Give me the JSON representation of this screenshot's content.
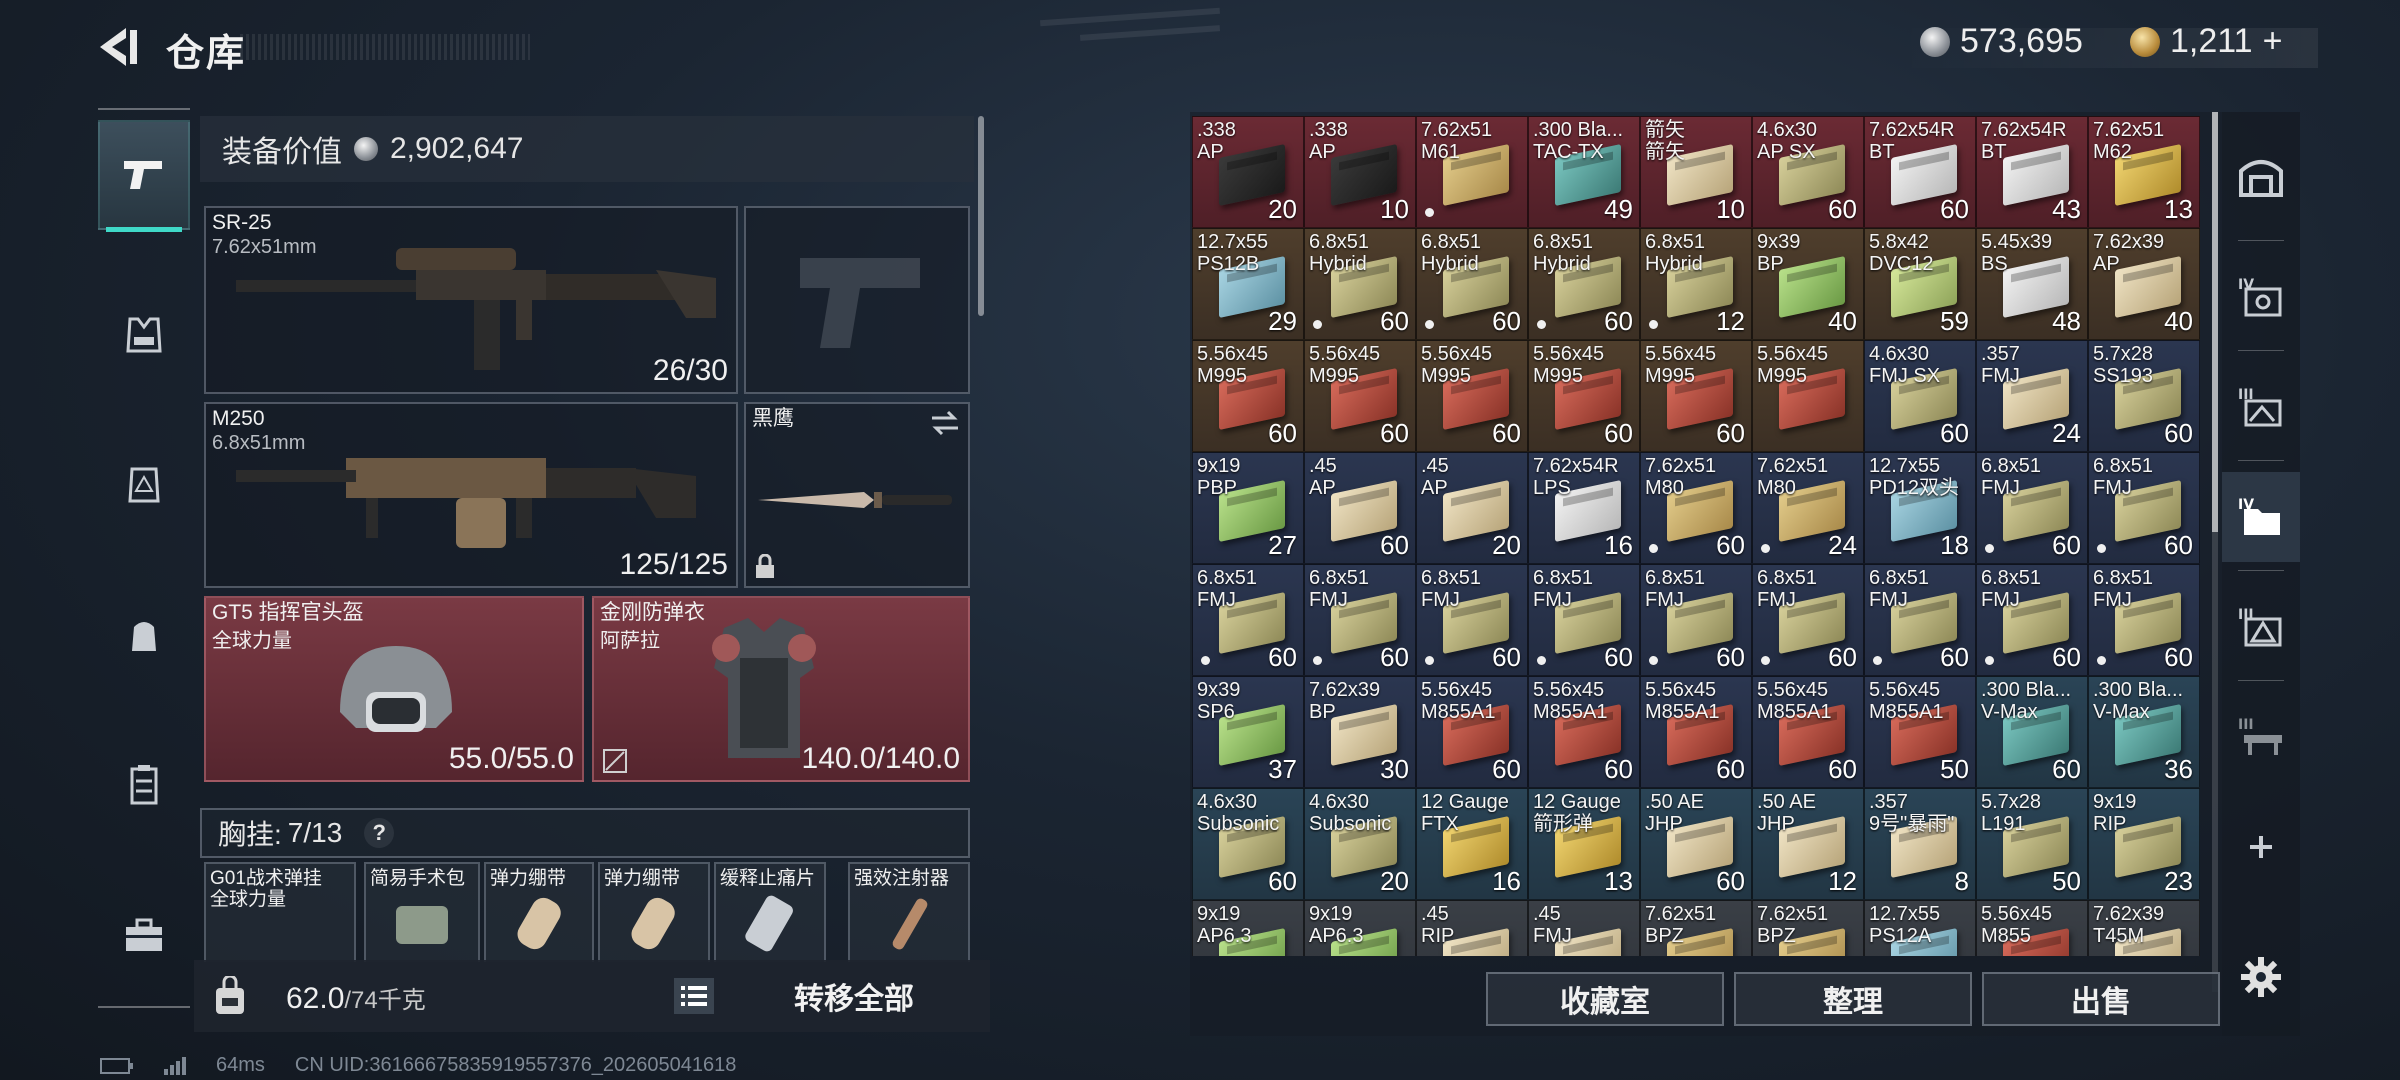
{
  "header": {
    "title": "仓库",
    "silver_amount": "573,695",
    "gold_amount": "1,211",
    "gold_plus": "+"
  },
  "loadout": {
    "equip_value_label": "装备价值",
    "equip_value": "2,902,647",
    "primary": {
      "name": "SR-25",
      "caliber": "7.62x51mm",
      "ammo": "26/30"
    },
    "secondary": {
      "name": "M250",
      "caliber": "6.8x51mm",
      "ammo": "125/125"
    },
    "melee": {
      "name": "黑鹰"
    },
    "helmet": {
      "name": "GT5 指挥官头盔",
      "brand": "全球力量",
      "durability": "55.0/55.0"
    },
    "armor": {
      "name": "金刚防弹衣",
      "brand": "阿萨拉",
      "durability": "140.0/140.0"
    },
    "chest_rig": {
      "label": "胸挂:",
      "count": "7/13",
      "help": "?"
    },
    "chest_items": [
      {
        "name": "G01战术弹挂",
        "sub": "全球力量"
      },
      {
        "name": "简易手术包",
        "sub": ""
      },
      {
        "name": "弹力绷带",
        "sub": ""
      },
      {
        "name": "弹力绷带",
        "sub": ""
      },
      {
        "name": "缓释止痛片",
        "sub": ""
      },
      {
        "name": "强效注射器",
        "sub": ""
      }
    ],
    "weight": "62.0",
    "weight_max": "/74千克",
    "transfer_all": "转移全部"
  },
  "status": {
    "ping": "64ms",
    "uid": "CN UID:36166675835919557376_202605041618"
  },
  "actions": {
    "collection": "收藏室",
    "sort": "整理",
    "sell": "出售"
  },
  "icons": {
    "back": "back-arrow-icon",
    "settings": "gear-icon",
    "add": "plus-icon"
  },
  "grid": [
    [
      {
        "cal": [
          ".338",
          "AP"
        ],
        "qty": "20",
        "bg": "red",
        "box": "black",
        "dot": false
      },
      {
        "cal": [
          ".338",
          "AP"
        ],
        "qty": "10",
        "bg": "red",
        "box": "black",
        "dot": false
      },
      {
        "cal": [
          "7.62x51",
          "M61"
        ],
        "qty": "",
        "bg": "red",
        "box": "tan",
        "dot": true
      },
      {
        "cal": [
          ".300 Bla...",
          "TAC-TX"
        ],
        "qty": "49",
        "bg": "red",
        "box": "teal",
        "dot": false
      },
      {
        "cal": [
          "箭矢",
          "箭矢"
        ],
        "qty": "10",
        "bg": "red",
        "box": "cream",
        "dot": false
      },
      {
        "cal": [
          "4.6x30",
          "AP SX"
        ],
        "qty": "60",
        "bg": "red",
        "box": "khaki",
        "dot": false
      },
      {
        "cal": [
          "7.62x54R",
          "BT"
        ],
        "qty": "60",
        "bg": "red",
        "box": "white",
        "dot": false
      },
      {
        "cal": [
          "7.62x54R",
          "BT"
        ],
        "qty": "43",
        "bg": "red",
        "box": "white",
        "dot": false
      },
      {
        "cal": [
          "7.62x51",
          "M62"
        ],
        "qty": "13",
        "bg": "red",
        "box": "yellow",
        "dot": false
      }
    ],
    [
      {
        "cal": [
          "12.7x55",
          "PS12B"
        ],
        "qty": "29",
        "bg": "brown",
        "box": "lblue",
        "dot": false
      },
      {
        "cal": [
          "6.8x51",
          "Hybrid"
        ],
        "qty": "60",
        "bg": "brown",
        "box": "khaki",
        "dot": true
      },
      {
        "cal": [
          "6.8x51",
          "Hybrid"
        ],
        "qty": "60",
        "bg": "brown",
        "box": "khaki",
        "dot": true
      },
      {
        "cal": [
          "6.8x51",
          "Hybrid"
        ],
        "qty": "60",
        "bg": "brown",
        "box": "khaki",
        "dot": true
      },
      {
        "cal": [
          "6.8x51",
          "Hybrid"
        ],
        "qty": "12",
        "bg": "brown",
        "box": "khaki",
        "dot": true
      },
      {
        "cal": [
          "9x39",
          "BP"
        ],
        "qty": "40",
        "bg": "brown",
        "box": "green",
        "dot": false
      },
      {
        "cal": [
          "5.8x42",
          "DVC12"
        ],
        "qty": "59",
        "bg": "brown",
        "box": "lime",
        "dot": false
      },
      {
        "cal": [
          "5.45x39",
          "BS"
        ],
        "qty": "48",
        "bg": "brown",
        "box": "white",
        "dot": false
      },
      {
        "cal": [
          "7.62x39",
          "AP"
        ],
        "qty": "40",
        "bg": "brown",
        "box": "cream",
        "dot": false
      }
    ],
    [
      {
        "cal": [
          "5.56x45",
          "M995"
        ],
        "qty": "60",
        "bg": "brown",
        "box": "red",
        "dot": false
      },
      {
        "cal": [
          "5.56x45",
          "M995"
        ],
        "qty": "60",
        "bg": "brown",
        "box": "red",
        "dot": false
      },
      {
        "cal": [
          "5.56x45",
          "M995"
        ],
        "qty": "60",
        "bg": "brown",
        "box": "red",
        "dot": false
      },
      {
        "cal": [
          "5.56x45",
          "M995"
        ],
        "qty": "60",
        "bg": "brown",
        "box": "red",
        "dot": false
      },
      {
        "cal": [
          "5.56x45",
          "M995"
        ],
        "qty": "60",
        "bg": "brown",
        "box": "red",
        "dot": false
      },
      {
        "cal": [
          "5.56x45",
          "M995"
        ],
        "qty": "",
        "bg": "brown",
        "box": "red",
        "dot": false
      },
      {
        "cal": [
          "4.6x30",
          "FMJ SX"
        ],
        "qty": "60",
        "bg": "navy",
        "box": "khaki",
        "dot": false
      },
      {
        "cal": [
          ".357",
          "FMJ"
        ],
        "qty": "24",
        "bg": "navy",
        "box": "cream",
        "dot": false
      },
      {
        "cal": [
          "5.7x28",
          "SS193"
        ],
        "qty": "60",
        "bg": "navy",
        "box": "khaki",
        "dot": false
      }
    ],
    [
      {
        "cal": [
          "9x19",
          "PBP"
        ],
        "qty": "27",
        "bg": "navy",
        "box": "green",
        "dot": false
      },
      {
        "cal": [
          ".45",
          "AP"
        ],
        "qty": "60",
        "bg": "navy",
        "box": "cream",
        "dot": false
      },
      {
        "cal": [
          ".45",
          "AP"
        ],
        "qty": "20",
        "bg": "navy",
        "box": "cream",
        "dot": false
      },
      {
        "cal": [
          "7.62x54R",
          "LPS"
        ],
        "qty": "16",
        "bg": "navy",
        "box": "white",
        "dot": false
      },
      {
        "cal": [
          "7.62x51",
          "M80"
        ],
        "qty": "60",
        "bg": "navy",
        "box": "tan",
        "dot": true
      },
      {
        "cal": [
          "7.62x51",
          "M80"
        ],
        "qty": "24",
        "bg": "navy",
        "box": "tan",
        "dot": true
      },
      {
        "cal": [
          "12.7x55",
          "PD12双头"
        ],
        "qty": "18",
        "bg": "navy",
        "box": "lblue",
        "dot": false
      },
      {
        "cal": [
          "6.8x51",
          "FMJ"
        ],
        "qty": "60",
        "bg": "navy",
        "box": "khaki",
        "dot": true
      },
      {
        "cal": [
          "6.8x51",
          "FMJ"
        ],
        "qty": "60",
        "bg": "navy",
        "box": "khaki",
        "dot": true
      }
    ],
    [
      {
        "cal": [
          "6.8x51",
          "FMJ"
        ],
        "qty": "60",
        "bg": "navy",
        "box": "khaki",
        "dot": true
      },
      {
        "cal": [
          "6.8x51",
          "FMJ"
        ],
        "qty": "60",
        "bg": "navy",
        "box": "khaki",
        "dot": true
      },
      {
        "cal": [
          "6.8x51",
          "FMJ"
        ],
        "qty": "60",
        "bg": "navy",
        "box": "khaki",
        "dot": true
      },
      {
        "cal": [
          "6.8x51",
          "FMJ"
        ],
        "qty": "60",
        "bg": "navy",
        "box": "khaki",
        "dot": true
      },
      {
        "cal": [
          "6.8x51",
          "FMJ"
        ],
        "qty": "60",
        "bg": "navy",
        "box": "khaki",
        "dot": true
      },
      {
        "cal": [
          "6.8x51",
          "FMJ"
        ],
        "qty": "60",
        "bg": "navy",
        "box": "khaki",
        "dot": true
      },
      {
        "cal": [
          "6.8x51",
          "FMJ"
        ],
        "qty": "60",
        "bg": "navy",
        "box": "khaki",
        "dot": true
      },
      {
        "cal": [
          "6.8x51",
          "FMJ"
        ],
        "qty": "60",
        "bg": "navy",
        "box": "khaki",
        "dot": true
      },
      {
        "cal": [
          "6.8x51",
          "FMJ"
        ],
        "qty": "60",
        "bg": "navy",
        "box": "khaki",
        "dot": true
      }
    ],
    [
      {
        "cal": [
          "9x39",
          "SP6"
        ],
        "qty": "37",
        "bg": "navy",
        "box": "green",
        "dot": false
      },
      {
        "cal": [
          "7.62x39",
          "BP"
        ],
        "qty": "30",
        "bg": "navy",
        "box": "cream",
        "dot": false
      },
      {
        "cal": [
          "5.56x45",
          "M855A1"
        ],
        "qty": "60",
        "bg": "navy",
        "box": "red",
        "dot": false
      },
      {
        "cal": [
          "5.56x45",
          "M855A1"
        ],
        "qty": "60",
        "bg": "navy",
        "box": "red",
        "dot": false
      },
      {
        "cal": [
          "5.56x45",
          "M855A1"
        ],
        "qty": "60",
        "bg": "navy",
        "box": "red",
        "dot": false
      },
      {
        "cal": [
          "5.56x45",
          "M855A1"
        ],
        "qty": "60",
        "bg": "navy",
        "box": "red",
        "dot": false
      },
      {
        "cal": [
          "5.56x45",
          "M855A1"
        ],
        "qty": "50",
        "bg": "navy",
        "box": "red",
        "dot": false
      },
      {
        "cal": [
          ".300 Bla...",
          "V-Max"
        ],
        "qty": "60",
        "bg": "teal",
        "box": "teal",
        "dot": false
      },
      {
        "cal": [
          ".300 Bla...",
          "V-Max"
        ],
        "qty": "36",
        "bg": "teal",
        "box": "teal",
        "dot": false
      }
    ],
    [
      {
        "cal": [
          "4.6x30",
          "Subsonic"
        ],
        "qty": "60",
        "bg": "teal",
        "box": "khaki",
        "dot": false
      },
      {
        "cal": [
          "4.6x30",
          "Subsonic"
        ],
        "qty": "20",
        "bg": "teal",
        "box": "khaki",
        "dot": false
      },
      {
        "cal": [
          "12 Gauge",
          "FTX"
        ],
        "qty": "16",
        "bg": "teal",
        "box": "yellow",
        "dot": false
      },
      {
        "cal": [
          "12 Gauge",
          "箭形弹"
        ],
        "qty": "13",
        "bg": "teal",
        "box": "yellow",
        "dot": false
      },
      {
        "cal": [
          ".50 AE",
          "JHP"
        ],
        "qty": "60",
        "bg": "teal",
        "box": "cream",
        "dot": false
      },
      {
        "cal": [
          ".50 AE",
          "JHP"
        ],
        "qty": "12",
        "bg": "teal",
        "box": "cream",
        "dot": false
      },
      {
        "cal": [
          ".357",
          "9号\"暴雨\""
        ],
        "qty": "8",
        "bg": "teal",
        "box": "cream",
        "dot": false
      },
      {
        "cal": [
          "5.7x28",
          "L191"
        ],
        "qty": "50",
        "bg": "teal",
        "box": "khaki",
        "dot": false
      },
      {
        "cal": [
          "9x19",
          "RIP"
        ],
        "qty": "23",
        "bg": "teal",
        "box": "khaki",
        "dot": false
      }
    ],
    [
      {
        "cal": [
          "9x19",
          "AP6.3"
        ],
        "qty": "",
        "bg": "gray",
        "box": "green",
        "dot": false
      },
      {
        "cal": [
          "9x19",
          "AP6.3"
        ],
        "qty": "",
        "bg": "gray",
        "box": "green",
        "dot": false
      },
      {
        "cal": [
          ".45",
          "RIP"
        ],
        "qty": "",
        "bg": "gray",
        "box": "cream",
        "dot": false
      },
      {
        "cal": [
          ".45",
          "FMJ"
        ],
        "qty": "",
        "bg": "gray",
        "box": "cream",
        "dot": false
      },
      {
        "cal": [
          "7.62x51",
          "BPZ"
        ],
        "qty": "",
        "bg": "gray",
        "box": "tan",
        "dot": false
      },
      {
        "cal": [
          "7.62x51",
          "BPZ"
        ],
        "qty": "",
        "bg": "gray",
        "box": "tan",
        "dot": false
      },
      {
        "cal": [
          "12.7x55",
          "PS12A"
        ],
        "qty": "",
        "bg": "gray",
        "box": "lblue",
        "dot": false
      },
      {
        "cal": [
          "5.56x45",
          "M855"
        ],
        "qty": "",
        "bg": "gray",
        "box": "red",
        "dot": false
      },
      {
        "cal": [
          "7.62x39",
          "T45M"
        ],
        "qty": "",
        "bg": "gray",
        "box": "cream",
        "dot": false
      }
    ]
  ]
}
